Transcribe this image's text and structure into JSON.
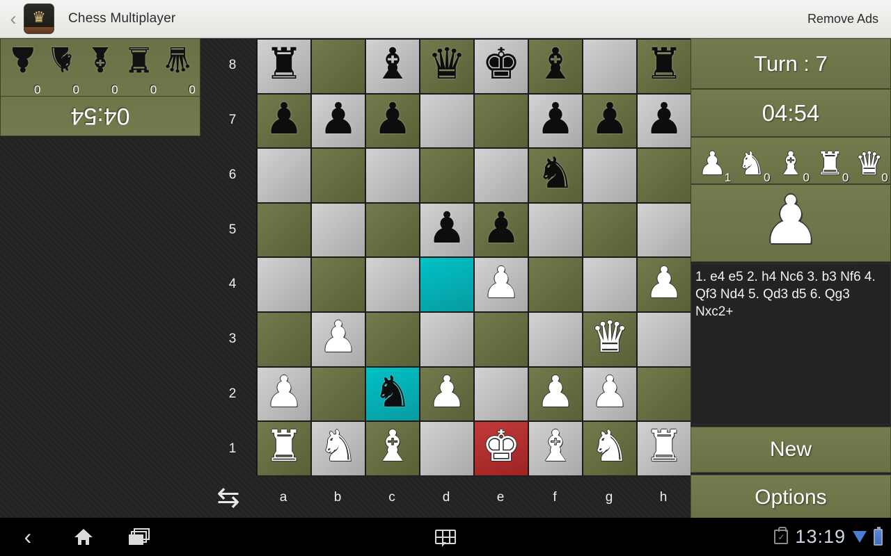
{
  "titlebar": {
    "back_icon": "chevron-left-icon",
    "app_icon": "chess-crown-icon",
    "title": "Chess Multiplayer",
    "remove_ads": "Remove Ads"
  },
  "black_player": {
    "timer": "04:54",
    "captures": [
      {
        "piece": "queen",
        "glyph": "♛",
        "count": "0"
      },
      {
        "piece": "rook",
        "glyph": "♜",
        "count": "0"
      },
      {
        "piece": "bishop",
        "glyph": "♝",
        "count": "0"
      },
      {
        "piece": "knight",
        "glyph": "♞",
        "count": "0"
      },
      {
        "piece": "pawn",
        "glyph": "♟",
        "count": "0"
      }
    ]
  },
  "white_player": {
    "turn_label": "Turn : 7",
    "timer": "04:54",
    "captures": [
      {
        "piece": "pawn",
        "glyph": "♟",
        "count": "1"
      },
      {
        "piece": "knight",
        "glyph": "♞",
        "count": "0"
      },
      {
        "piece": "bishop",
        "glyph": "♝",
        "count": "0"
      },
      {
        "piece": "rook",
        "glyph": "♜",
        "count": "0"
      },
      {
        "piece": "queen",
        "glyph": "♛",
        "count": "0"
      }
    ],
    "last_captured_piece": "♟"
  },
  "moves": {
    "text": "1. e4 e5 2. h4 Nc6 3. b3 Nf6 4. Qf3 Nd4 5. Qd3 d5 6. Qg3 Nxc2+"
  },
  "buttons": {
    "new": "New",
    "options": "Options"
  },
  "board": {
    "flip_icon": "flip-board-icon",
    "rank_labels": [
      "8",
      "7",
      "6",
      "5",
      "4",
      "3",
      "2",
      "1"
    ],
    "file_labels": [
      "a",
      "b",
      "c",
      "d",
      "e",
      "f",
      "g",
      "h"
    ],
    "colors": {
      "light_square": "#d2d2d2",
      "dark_square": "#6b7046",
      "highlight": "#00b8bd",
      "check": "#b93030"
    },
    "squares": [
      [
        {
          "p": "♜",
          "c": "b"
        },
        {
          "p": "",
          "c": ""
        },
        {
          "p": "♝",
          "c": "b"
        },
        {
          "p": "♛",
          "c": "b"
        },
        {
          "p": "♚",
          "c": "b"
        },
        {
          "p": "♝",
          "c": "b"
        },
        {
          "p": "",
          "c": ""
        },
        {
          "p": "♜",
          "c": "b"
        }
      ],
      [
        {
          "p": "♟",
          "c": "b"
        },
        {
          "p": "♟",
          "c": "b"
        },
        {
          "p": "♟",
          "c": "b"
        },
        {
          "p": "",
          "c": ""
        },
        {
          "p": "",
          "c": ""
        },
        {
          "p": "♟",
          "c": "b"
        },
        {
          "p": "♟",
          "c": "b"
        },
        {
          "p": "♟",
          "c": "b"
        }
      ],
      [
        {
          "p": "",
          "c": ""
        },
        {
          "p": "",
          "c": ""
        },
        {
          "p": "",
          "c": ""
        },
        {
          "p": "",
          "c": ""
        },
        {
          "p": "",
          "c": ""
        },
        {
          "p": "♞",
          "c": "b"
        },
        {
          "p": "",
          "c": ""
        },
        {
          "p": "",
          "c": ""
        }
      ],
      [
        {
          "p": "",
          "c": ""
        },
        {
          "p": "",
          "c": ""
        },
        {
          "p": "",
          "c": ""
        },
        {
          "p": "♟",
          "c": "b"
        },
        {
          "p": "♟",
          "c": "b"
        },
        {
          "p": "",
          "c": ""
        },
        {
          "p": "",
          "c": ""
        },
        {
          "p": "",
          "c": ""
        }
      ],
      [
        {
          "p": "",
          "c": ""
        },
        {
          "p": "",
          "c": ""
        },
        {
          "p": "",
          "c": ""
        },
        {
          "p": "",
          "c": "",
          "hl": true
        },
        {
          "p": "♟",
          "c": "w"
        },
        {
          "p": "",
          "c": ""
        },
        {
          "p": "",
          "c": ""
        },
        {
          "p": "♟",
          "c": "w"
        }
      ],
      [
        {
          "p": "",
          "c": ""
        },
        {
          "p": "♟",
          "c": "w"
        },
        {
          "p": "",
          "c": ""
        },
        {
          "p": "",
          "c": ""
        },
        {
          "p": "",
          "c": ""
        },
        {
          "p": "",
          "c": ""
        },
        {
          "p": "♛",
          "c": "w"
        },
        {
          "p": "",
          "c": ""
        }
      ],
      [
        {
          "p": "♟",
          "c": "w"
        },
        {
          "p": "",
          "c": ""
        },
        {
          "p": "♞",
          "c": "b",
          "hl": true
        },
        {
          "p": "♟",
          "c": "w"
        },
        {
          "p": "",
          "c": ""
        },
        {
          "p": "♟",
          "c": "w"
        },
        {
          "p": "♟",
          "c": "w"
        },
        {
          "p": "",
          "c": ""
        }
      ],
      [
        {
          "p": "♜",
          "c": "w"
        },
        {
          "p": "♞",
          "c": "w"
        },
        {
          "p": "♝",
          "c": "w"
        },
        {
          "p": "",
          "c": ""
        },
        {
          "p": "♚",
          "c": "w",
          "check": true
        },
        {
          "p": "♝",
          "c": "w"
        },
        {
          "p": "♞",
          "c": "w"
        },
        {
          "p": "♜",
          "c": "w"
        }
      ]
    ]
  },
  "system_bar": {
    "back_icon": "back-icon",
    "home_icon": "home-icon",
    "recents_icon": "recent-apps-icon",
    "keyboard_icon": "keyboard-switcher-icon",
    "usb_icon": "usb-debug-icon",
    "clock": "13:19",
    "signal_icon": "signal-icon",
    "battery_icon": "battery-icon"
  }
}
